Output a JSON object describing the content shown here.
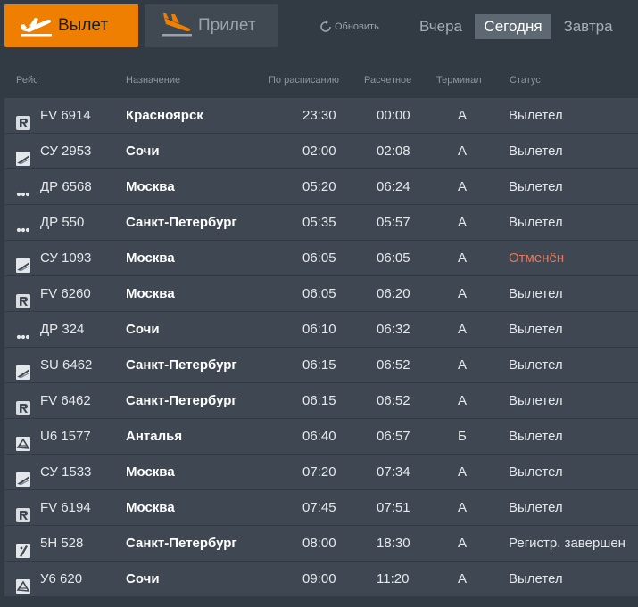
{
  "tabs": {
    "departure_label": "Вылет",
    "arrival_label": "Прилет"
  },
  "refresh_label": "Обновить",
  "days": {
    "yesterday": "Вчера",
    "today": "Сегодня",
    "tomorrow": "Завтра"
  },
  "columns": {
    "flight": "Рейс",
    "destination": "Назначение",
    "scheduled": "По расписанию",
    "estimated": "Расчетное",
    "terminal": "Терминал",
    "status": "Статус"
  },
  "colors": {
    "accent": "#ee7f00",
    "cancelled": "#e8775a"
  },
  "flights": [
    {
      "airline_icon": "r-logo-icon",
      "flight": "FV 6914",
      "destination": "Красноярск",
      "scheduled": "23:30",
      "estimated": "00:00",
      "terminal": "A",
      "status": "Вылетел"
    },
    {
      "airline_icon": "wing-logo-icon",
      "flight": "СУ 2953",
      "destination": "Сочи",
      "scheduled": "02:00",
      "estimated": "02:08",
      "terminal": "A",
      "status": "Вылетел"
    },
    {
      "airline_icon": "dots-logo-icon",
      "flight": "ДР 6568",
      "destination": "Москва",
      "scheduled": "05:20",
      "estimated": "06:24",
      "terminal": "A",
      "status": "Вылетел"
    },
    {
      "airline_icon": "dots-logo-icon",
      "flight": "ДР 550",
      "destination": "Санкт-Петербург",
      "scheduled": "05:35",
      "estimated": "05:57",
      "terminal": "A",
      "status": "Вылетел"
    },
    {
      "airline_icon": "wing-logo-icon",
      "flight": "СУ 1093",
      "destination": "Москва",
      "scheduled": "06:05",
      "estimated": "06:05",
      "terminal": "A",
      "status": "Отменён",
      "cancelled": true
    },
    {
      "airline_icon": "r-logo-icon",
      "flight": "FV 6260",
      "destination": "Москва",
      "scheduled": "06:05",
      "estimated": "06:20",
      "terminal": "A",
      "status": "Вылетел"
    },
    {
      "airline_icon": "dots-logo-icon",
      "flight": "ДР 324",
      "destination": "Сочи",
      "scheduled": "06:10",
      "estimated": "06:32",
      "terminal": "A",
      "status": "Вылетел"
    },
    {
      "airline_icon": "wing-logo-icon",
      "flight": "SU 6462",
      "destination": "Санкт-Петербург",
      "scheduled": "06:15",
      "estimated": "06:52",
      "terminal": "A",
      "status": "Вылетел"
    },
    {
      "airline_icon": "r-logo-icon",
      "flight": "FV 6462",
      "destination": "Санкт-Петербург",
      "scheduled": "06:15",
      "estimated": "06:52",
      "terminal": "A",
      "status": "Вылетел"
    },
    {
      "airline_icon": "bird-logo-icon",
      "flight": "U6 1577",
      "destination": "Анталья",
      "scheduled": "06:40",
      "estimated": "06:57",
      "terminal": "Б",
      "status": "Вылетел"
    },
    {
      "airline_icon": "wing-logo-icon",
      "flight": "СУ 1533",
      "destination": "Москва",
      "scheduled": "07:20",
      "estimated": "07:34",
      "terminal": "A",
      "status": "Вылетел"
    },
    {
      "airline_icon": "r-logo-icon",
      "flight": "FV 6194",
      "destination": "Москва",
      "scheduled": "07:45",
      "estimated": "07:51",
      "terminal": "A",
      "status": "Вылетел"
    },
    {
      "airline_icon": "slash-logo-icon",
      "flight": "5H 528",
      "destination": "Санкт-Петербург",
      "scheduled": "08:00",
      "estimated": "18:30",
      "terminal": "A",
      "status": "Регистр. завершен"
    },
    {
      "airline_icon": "bird-logo-icon",
      "flight": "У6 620",
      "destination": "Сочи",
      "scheduled": "09:00",
      "estimated": "11:20",
      "terminal": "A",
      "status": "Вылетел"
    }
  ]
}
